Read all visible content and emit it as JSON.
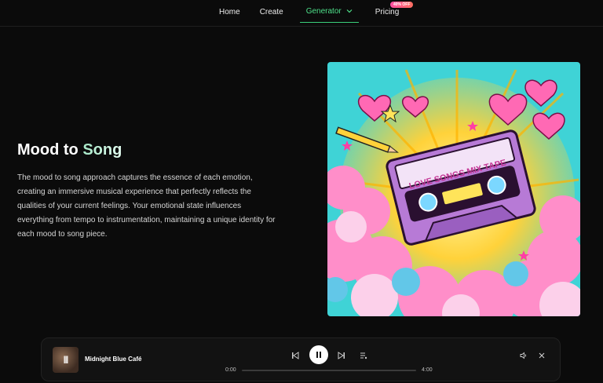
{
  "nav": {
    "items": [
      {
        "label": "Home"
      },
      {
        "label": "Create"
      },
      {
        "label": "Generator"
      },
      {
        "label": "Pricing"
      }
    ],
    "pricing_badge": "40% OFF"
  },
  "hero": {
    "title_prefix": "Mood to ",
    "title_accent": "Song",
    "description": "The mood to song approach captures the essence of each emotion, creating an immersive musical experience that perfectly reflects the qualities of your current feelings. Your emotional state influences everything from tempo to instrumentation, maintaining a unique identity for each mood to song piece."
  },
  "artwork": {
    "cassette_label": "LOVE SONGS MIX TAPE"
  },
  "player": {
    "song_title": "Midnight Blue Café",
    "current_time": "0:00",
    "total_time": "4:00",
    "progress": 0
  },
  "colors": {
    "accent": "#3bd07a",
    "background": "#0b0b0b",
    "player_bg": "#121212"
  }
}
